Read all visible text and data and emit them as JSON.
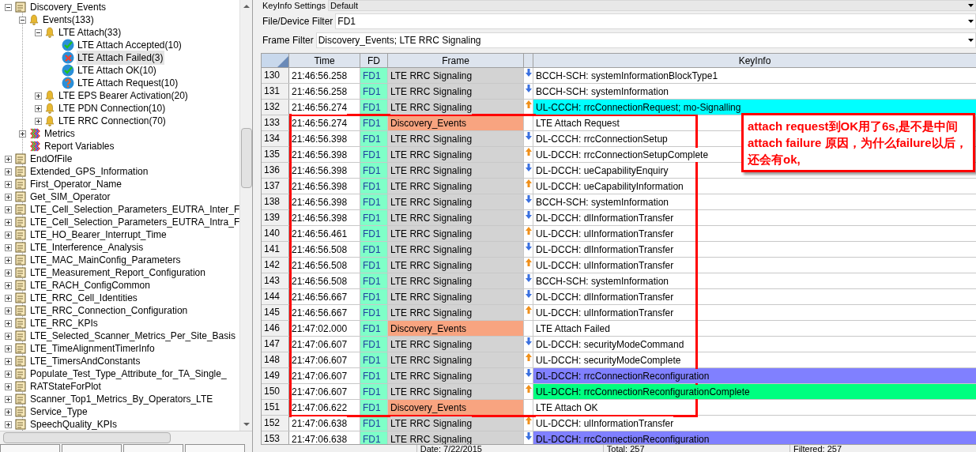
{
  "tree": [
    {
      "label": "Discovery_Events",
      "kind": "file",
      "expanded": true,
      "selected": false,
      "children": [
        {
          "label": "Events(133)",
          "kind": "bell",
          "expanded": true,
          "selected": false,
          "children": [
            {
              "label": "LTE Attach(33)",
              "kind": "bell",
              "expanded": true,
              "selected": false,
              "children": [
                {
                  "label": "LTE Attach Accepted(10)",
                  "kind": "check",
                  "selected": false
                },
                {
                  "label": "LTE Attach Failed(3)",
                  "kind": "cross",
                  "selected": true
                },
                {
                  "label": "LTE Attach OK(10)",
                  "kind": "check",
                  "selected": false
                },
                {
                  "label": "LTE Attach Request(10)",
                  "kind": "question",
                  "selected": false
                }
              ]
            },
            {
              "label": "LTE EPS Bearer Activation(20)",
              "kind": "bell",
              "expanded": false,
              "selected": false
            },
            {
              "label": "LTE PDN Connection(10)",
              "kind": "bell",
              "expanded": false,
              "selected": false
            },
            {
              "label": "LTE RRC Connection(70)",
              "kind": "bell",
              "expanded": false,
              "selected": false
            }
          ]
        },
        {
          "label": "Metrics",
          "kind": "metrics",
          "expanded": false,
          "selected": false
        },
        {
          "label": "Report Variables",
          "kind": "metrics",
          "selected": false
        }
      ]
    },
    {
      "label": "EndOfFile",
      "kind": "file",
      "expanded": false,
      "selected": false
    },
    {
      "label": "Extended_GPS_Information",
      "kind": "file",
      "expanded": false,
      "selected": false
    },
    {
      "label": "First_Operator_Name",
      "kind": "file",
      "expanded": false,
      "selected": false
    },
    {
      "label": "Get_SIM_Operator",
      "kind": "file",
      "expanded": false,
      "selected": false
    },
    {
      "label": "LTE_Cell_Selection_Parameters_EUTRA_Inter_F",
      "kind": "file",
      "expanded": false,
      "selected": false
    },
    {
      "label": "LTE_Cell_Selection_Parameters_EUTRA_Intra_F",
      "kind": "file",
      "expanded": false,
      "selected": false
    },
    {
      "label": "LTE_HO_Bearer_Interrupt_Time",
      "kind": "file",
      "expanded": false,
      "selected": false
    },
    {
      "label": "LTE_Interference_Analysis",
      "kind": "file",
      "expanded": false,
      "selected": false
    },
    {
      "label": "LTE_MAC_MainConfig_Parameters",
      "kind": "file",
      "expanded": false,
      "selected": false
    },
    {
      "label": "LTE_Measurement_Report_Configuration",
      "kind": "file",
      "expanded": false,
      "selected": false
    },
    {
      "label": "LTE_RACH_ConfigCommon",
      "kind": "file",
      "expanded": false,
      "selected": false
    },
    {
      "label": "LTE_RRC_Cell_Identities",
      "kind": "file",
      "expanded": false,
      "selected": false
    },
    {
      "label": "LTE_RRC_Connection_Configuration",
      "kind": "file",
      "expanded": false,
      "selected": false
    },
    {
      "label": "LTE_RRC_KPIs",
      "kind": "file",
      "expanded": false,
      "selected": false
    },
    {
      "label": "LTE_Selected_Scanner_Metrics_Per_Site_Basis",
      "kind": "file",
      "expanded": false,
      "selected": false
    },
    {
      "label": "LTE_TimeAlignmentTimerInfo",
      "kind": "file",
      "expanded": false,
      "selected": false
    },
    {
      "label": "LTE_TimersAndConstants",
      "kind": "file",
      "expanded": false,
      "selected": false
    },
    {
      "label": "Populate_Test_Type_Attribute_for_TA_Single_",
      "kind": "file",
      "expanded": false,
      "selected": false
    },
    {
      "label": "RATStateForPlot",
      "kind": "file",
      "expanded": false,
      "selected": false
    },
    {
      "label": "Scanner_Top1_Metrics_By_Operators_LTE",
      "kind": "file",
      "expanded": false,
      "selected": false
    },
    {
      "label": "Service_Type",
      "kind": "file",
      "expanded": false,
      "selected": false
    },
    {
      "label": "SpeechQuality_KPIs",
      "kind": "file",
      "expanded": false,
      "selected": false
    }
  ],
  "filters": [
    {
      "label": "KeyInfo Settings",
      "value": "Default"
    },
    {
      "label": "File/Device Filter",
      "value": "FD1"
    },
    {
      "label": "Frame Filter",
      "value": "Discovery_Events; LTE RRC Signaling"
    }
  ],
  "table": {
    "columns": [
      "Time",
      "FD",
      "Frame",
      "KeyInfo"
    ],
    "rows": [
      {
        "index": "130",
        "time": "21:46:56.258",
        "fd": "FD1",
        "frame": "LTE RRC Signaling",
        "kind": "downlink",
        "keyinfo": "BCCH-SCH: systemInformationBlockType1"
      },
      {
        "index": "131",
        "time": "21:46:56.258",
        "fd": "FD1",
        "frame": "LTE RRC Signaling",
        "kind": "downlink",
        "keyinfo": "BCCH-SCH: systemInformation"
      },
      {
        "index": "132",
        "time": "21:46:56.274",
        "fd": "FD1",
        "frame": "LTE RRC Signaling",
        "kind": "uplink",
        "keyinfo": "UL-CCCH: rrcConnectionRequest;  mo-Signalling",
        "color": "#00ffff"
      },
      {
        "index": "133",
        "time": "21:46:56.274",
        "fd": "FD1",
        "frame": "Discovery_Events",
        "kind": "event",
        "keyinfo": "LTE Attach Request"
      },
      {
        "index": "134",
        "time": "21:46:56.398",
        "fd": "FD1",
        "frame": "LTE RRC Signaling",
        "kind": "downlink",
        "keyinfo": "DL-CCCH: rrcConnectionSetup"
      },
      {
        "index": "135",
        "time": "21:46:56.398",
        "fd": "FD1",
        "frame": "LTE RRC Signaling",
        "kind": "uplink",
        "keyinfo": "UL-DCCH: rrcConnectionSetupComplete"
      },
      {
        "index": "136",
        "time": "21:46:56.398",
        "fd": "FD1",
        "frame": "LTE RRC Signaling",
        "kind": "downlink",
        "keyinfo": "DL-DCCH: ueCapabilityEnquiry"
      },
      {
        "index": "137",
        "time": "21:46:56.398",
        "fd": "FD1",
        "frame": "LTE RRC Signaling",
        "kind": "uplink",
        "keyinfo": "UL-DCCH: ueCapabilityInformation"
      },
      {
        "index": "138",
        "time": "21:46:56.398",
        "fd": "FD1",
        "frame": "LTE RRC Signaling",
        "kind": "downlink",
        "keyinfo": "BCCH-SCH: systemInformation"
      },
      {
        "index": "139",
        "time": "21:46:56.398",
        "fd": "FD1",
        "frame": "LTE RRC Signaling",
        "kind": "downlink",
        "keyinfo": "DL-DCCH: dlInformationTransfer"
      },
      {
        "index": "140",
        "time": "21:46:56.461",
        "fd": "FD1",
        "frame": "LTE RRC Signaling",
        "kind": "uplink",
        "keyinfo": "UL-DCCH: ulInformationTransfer"
      },
      {
        "index": "141",
        "time": "21:46:56.508",
        "fd": "FD1",
        "frame": "LTE RRC Signaling",
        "kind": "downlink",
        "keyinfo": "DL-DCCH: dlInformationTransfer"
      },
      {
        "index": "142",
        "time": "21:46:56.508",
        "fd": "FD1",
        "frame": "LTE RRC Signaling",
        "kind": "uplink",
        "keyinfo": "UL-DCCH: ulInformationTransfer"
      },
      {
        "index": "143",
        "time": "21:46:56.508",
        "fd": "FD1",
        "frame": "LTE RRC Signaling",
        "kind": "downlink",
        "keyinfo": "BCCH-SCH: systemInformation"
      },
      {
        "index": "144",
        "time": "21:46:56.667",
        "fd": "FD1",
        "frame": "LTE RRC Signaling",
        "kind": "downlink",
        "keyinfo": "DL-DCCH: dlInformationTransfer"
      },
      {
        "index": "145",
        "time": "21:46:56.667",
        "fd": "FD1",
        "frame": "LTE RRC Signaling",
        "kind": "uplink",
        "keyinfo": "UL-DCCH: ulInformationTransfer"
      },
      {
        "index": "146",
        "time": "21:47:02.000",
        "fd": "FD1",
        "frame": "Discovery_Events",
        "kind": "event",
        "keyinfo": "LTE Attach Failed"
      },
      {
        "index": "147",
        "time": "21:47:06.607",
        "fd": "FD1",
        "frame": "LTE RRC Signaling",
        "kind": "downlink",
        "keyinfo": "DL-DCCH: securityModeCommand"
      },
      {
        "index": "148",
        "time": "21:47:06.607",
        "fd": "FD1",
        "frame": "LTE RRC Signaling",
        "kind": "uplink",
        "keyinfo": "UL-DCCH: securityModeComplete"
      },
      {
        "index": "149",
        "time": "21:47:06.607",
        "fd": "FD1",
        "frame": "LTE RRC Signaling",
        "kind": "downlink",
        "keyinfo": "DL-DCCH: rrcConnectionReconfiguration",
        "color": "#8080ff"
      },
      {
        "index": "150",
        "time": "21:47:06.607",
        "fd": "FD1",
        "frame": "LTE RRC Signaling",
        "kind": "uplink",
        "keyinfo": "UL-DCCH: rrcConnectionReconfigurationComplete",
        "color": "#00ff80"
      },
      {
        "index": "151",
        "time": "21:47:06.622",
        "fd": "FD1",
        "frame": "Discovery_Events",
        "kind": "event",
        "keyinfo": "LTE Attach OK"
      },
      {
        "index": "152",
        "time": "21:47:06.638",
        "fd": "FD1",
        "frame": "LTE RRC Signaling",
        "kind": "uplink",
        "keyinfo": "UL-DCCH: ulInformationTransfer"
      },
      {
        "index": "153",
        "time": "21:47:06.638",
        "fd": "FD1",
        "frame": "LTE RRC Signaling",
        "kind": "downlink",
        "keyinfo": "DL-DCCH: rrcConnectionReconfiguration",
        "color": "#8080ff"
      }
    ]
  },
  "annotation": {
    "text": "attach request到OK用了6s,是不是中间attach failure 原因，为什么failure以后，还会有ok,"
  },
  "status_bar": [
    "Date: 7/22/2015",
    "Total: 257",
    "Filtered: 257"
  ]
}
